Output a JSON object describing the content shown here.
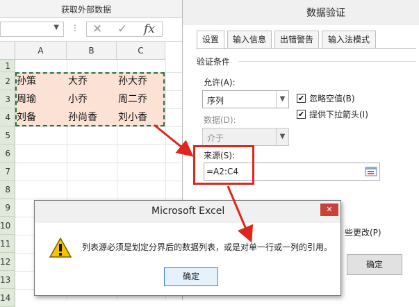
{
  "excel": {
    "ribbon_group_label": "获取外部数据",
    "formula_buttons": [
      "✕",
      "✓"
    ],
    "fx_label": "fx",
    "columns": [
      "A",
      "B",
      "C"
    ],
    "rows": [
      "1",
      "2",
      "3",
      "4",
      "5",
      "6",
      "7",
      "8",
      "9",
      "10",
      "11",
      "12",
      "13",
      "14"
    ],
    "cells": [
      [
        "孙策",
        "大乔",
        "孙大乔"
      ],
      [
        "周瑜",
        "小乔",
        "周二乔"
      ],
      [
        "刘备",
        "孙尚香",
        "刘小香"
      ]
    ],
    "selection_color": "#fbe2d5",
    "marquee_color": "#217346"
  },
  "validation_dialog": {
    "title": "数据验证",
    "tabs": [
      "设置",
      "输入信息",
      "出错警告",
      "输入法模式"
    ],
    "section_label": "验证条件",
    "allow_label": "允许(A):",
    "allow_value": "序列",
    "data_label": "数据(D):",
    "data_value": "介于",
    "ignore_blank_label": "忽略空值(B)",
    "ignore_blank_checked": true,
    "dropdown_label": "提供下拉箭头(I)",
    "dropdown_checked": true,
    "source_label": "来源(S):",
    "source_value": "=A2:C4",
    "partial_changes_label": "些更改(P)",
    "ok_label": "确定",
    "highlight_color": "#e0261c"
  },
  "error_popup": {
    "title": "Microsoft Excel",
    "message": "列表源必须是划定分界后的数据列表，或是对单一行或一列的引用。",
    "ok_label": "确定",
    "icon": "warning-icon"
  }
}
